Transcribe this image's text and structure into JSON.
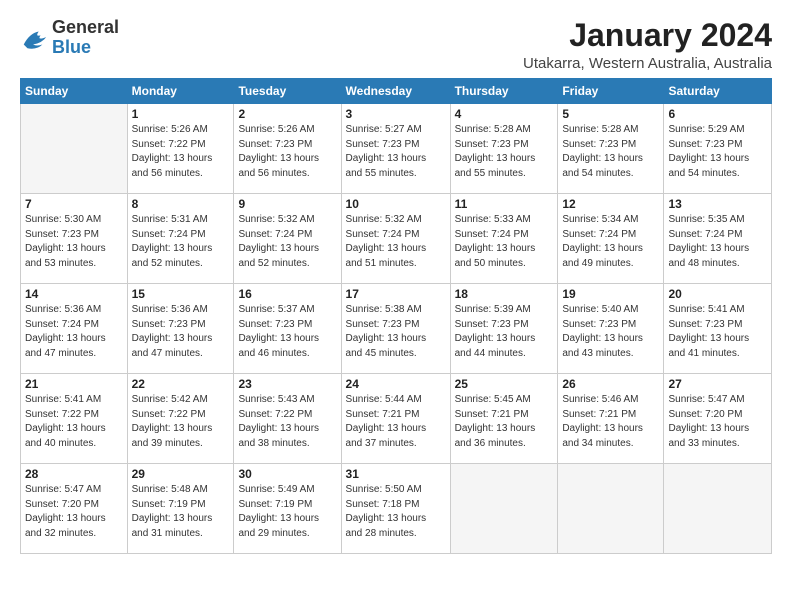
{
  "header": {
    "logo_general": "General",
    "logo_blue": "Blue",
    "month": "January 2024",
    "location": "Utakarra, Western Australia, Australia"
  },
  "weekdays": [
    "Sunday",
    "Monday",
    "Tuesday",
    "Wednesday",
    "Thursday",
    "Friday",
    "Saturday"
  ],
  "weeks": [
    [
      {
        "day": "",
        "sunrise": "",
        "sunset": "",
        "daylight": ""
      },
      {
        "day": "1",
        "sunrise": "Sunrise: 5:26 AM",
        "sunset": "Sunset: 7:22 PM",
        "daylight": "Daylight: 13 hours and 56 minutes."
      },
      {
        "day": "2",
        "sunrise": "Sunrise: 5:26 AM",
        "sunset": "Sunset: 7:23 PM",
        "daylight": "Daylight: 13 hours and 56 minutes."
      },
      {
        "day": "3",
        "sunrise": "Sunrise: 5:27 AM",
        "sunset": "Sunset: 7:23 PM",
        "daylight": "Daylight: 13 hours and 55 minutes."
      },
      {
        "day": "4",
        "sunrise": "Sunrise: 5:28 AM",
        "sunset": "Sunset: 7:23 PM",
        "daylight": "Daylight: 13 hours and 55 minutes."
      },
      {
        "day": "5",
        "sunrise": "Sunrise: 5:28 AM",
        "sunset": "Sunset: 7:23 PM",
        "daylight": "Daylight: 13 hours and 54 minutes."
      },
      {
        "day": "6",
        "sunrise": "Sunrise: 5:29 AM",
        "sunset": "Sunset: 7:23 PM",
        "daylight": "Daylight: 13 hours and 54 minutes."
      }
    ],
    [
      {
        "day": "7",
        "sunrise": "Sunrise: 5:30 AM",
        "sunset": "Sunset: 7:23 PM",
        "daylight": "Daylight: 13 hours and 53 minutes."
      },
      {
        "day": "8",
        "sunrise": "Sunrise: 5:31 AM",
        "sunset": "Sunset: 7:24 PM",
        "daylight": "Daylight: 13 hours and 52 minutes."
      },
      {
        "day": "9",
        "sunrise": "Sunrise: 5:32 AM",
        "sunset": "Sunset: 7:24 PM",
        "daylight": "Daylight: 13 hours and 52 minutes."
      },
      {
        "day": "10",
        "sunrise": "Sunrise: 5:32 AM",
        "sunset": "Sunset: 7:24 PM",
        "daylight": "Daylight: 13 hours and 51 minutes."
      },
      {
        "day": "11",
        "sunrise": "Sunrise: 5:33 AM",
        "sunset": "Sunset: 7:24 PM",
        "daylight": "Daylight: 13 hours and 50 minutes."
      },
      {
        "day": "12",
        "sunrise": "Sunrise: 5:34 AM",
        "sunset": "Sunset: 7:24 PM",
        "daylight": "Daylight: 13 hours and 49 minutes."
      },
      {
        "day": "13",
        "sunrise": "Sunrise: 5:35 AM",
        "sunset": "Sunset: 7:24 PM",
        "daylight": "Daylight: 13 hours and 48 minutes."
      }
    ],
    [
      {
        "day": "14",
        "sunrise": "Sunrise: 5:36 AM",
        "sunset": "Sunset: 7:24 PM",
        "daylight": "Daylight: 13 hours and 47 minutes."
      },
      {
        "day": "15",
        "sunrise": "Sunrise: 5:36 AM",
        "sunset": "Sunset: 7:23 PM",
        "daylight": "Daylight: 13 hours and 47 minutes."
      },
      {
        "day": "16",
        "sunrise": "Sunrise: 5:37 AM",
        "sunset": "Sunset: 7:23 PM",
        "daylight": "Daylight: 13 hours and 46 minutes."
      },
      {
        "day": "17",
        "sunrise": "Sunrise: 5:38 AM",
        "sunset": "Sunset: 7:23 PM",
        "daylight": "Daylight: 13 hours and 45 minutes."
      },
      {
        "day": "18",
        "sunrise": "Sunrise: 5:39 AM",
        "sunset": "Sunset: 7:23 PM",
        "daylight": "Daylight: 13 hours and 44 minutes."
      },
      {
        "day": "19",
        "sunrise": "Sunrise: 5:40 AM",
        "sunset": "Sunset: 7:23 PM",
        "daylight": "Daylight: 13 hours and 43 minutes."
      },
      {
        "day": "20",
        "sunrise": "Sunrise: 5:41 AM",
        "sunset": "Sunset: 7:23 PM",
        "daylight": "Daylight: 13 hours and 41 minutes."
      }
    ],
    [
      {
        "day": "21",
        "sunrise": "Sunrise: 5:41 AM",
        "sunset": "Sunset: 7:22 PM",
        "daylight": "Daylight: 13 hours and 40 minutes."
      },
      {
        "day": "22",
        "sunrise": "Sunrise: 5:42 AM",
        "sunset": "Sunset: 7:22 PM",
        "daylight": "Daylight: 13 hours and 39 minutes."
      },
      {
        "day": "23",
        "sunrise": "Sunrise: 5:43 AM",
        "sunset": "Sunset: 7:22 PM",
        "daylight": "Daylight: 13 hours and 38 minutes."
      },
      {
        "day": "24",
        "sunrise": "Sunrise: 5:44 AM",
        "sunset": "Sunset: 7:21 PM",
        "daylight": "Daylight: 13 hours and 37 minutes."
      },
      {
        "day": "25",
        "sunrise": "Sunrise: 5:45 AM",
        "sunset": "Sunset: 7:21 PM",
        "daylight": "Daylight: 13 hours and 36 minutes."
      },
      {
        "day": "26",
        "sunrise": "Sunrise: 5:46 AM",
        "sunset": "Sunset: 7:21 PM",
        "daylight": "Daylight: 13 hours and 34 minutes."
      },
      {
        "day": "27",
        "sunrise": "Sunrise: 5:47 AM",
        "sunset": "Sunset: 7:20 PM",
        "daylight": "Daylight: 13 hours and 33 minutes."
      }
    ],
    [
      {
        "day": "28",
        "sunrise": "Sunrise: 5:47 AM",
        "sunset": "Sunset: 7:20 PM",
        "daylight": "Daylight: 13 hours and 32 minutes."
      },
      {
        "day": "29",
        "sunrise": "Sunrise: 5:48 AM",
        "sunset": "Sunset: 7:19 PM",
        "daylight": "Daylight: 13 hours and 31 minutes."
      },
      {
        "day": "30",
        "sunrise": "Sunrise: 5:49 AM",
        "sunset": "Sunset: 7:19 PM",
        "daylight": "Daylight: 13 hours and 29 minutes."
      },
      {
        "day": "31",
        "sunrise": "Sunrise: 5:50 AM",
        "sunset": "Sunset: 7:18 PM",
        "daylight": "Daylight: 13 hours and 28 minutes."
      },
      {
        "day": "",
        "sunrise": "",
        "sunset": "",
        "daylight": ""
      },
      {
        "day": "",
        "sunrise": "",
        "sunset": "",
        "daylight": ""
      },
      {
        "day": "",
        "sunrise": "",
        "sunset": "",
        "daylight": ""
      }
    ]
  ]
}
